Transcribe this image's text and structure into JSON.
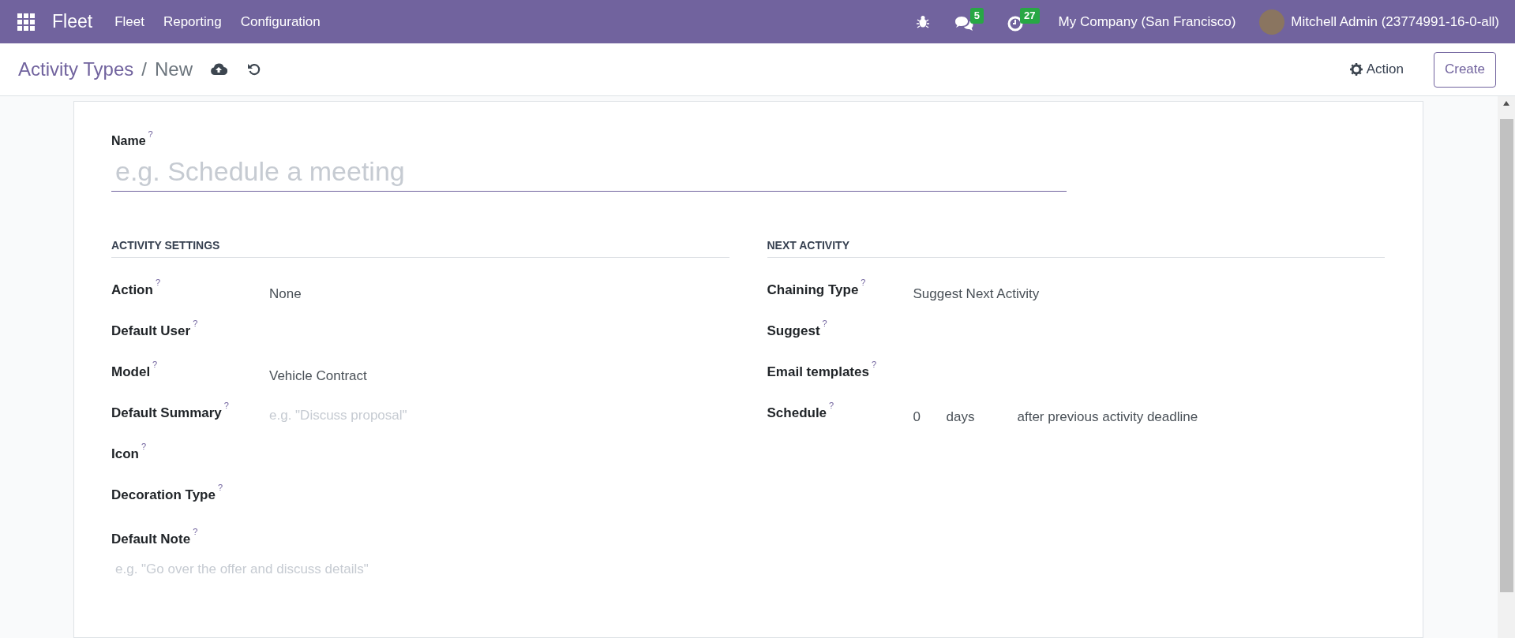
{
  "navbar": {
    "app_name": "Fleet",
    "menus": [
      "Fleet",
      "Reporting",
      "Configuration"
    ],
    "message_count": "5",
    "activity_count": "27",
    "company": "My Company (San Francisco)",
    "user": "Mitchell Admin (23774991-16-0-all)"
  },
  "control_panel": {
    "breadcrumb": "Activity Types",
    "separator": "/",
    "current": "New",
    "action_button": "Action",
    "create_button": "Create"
  },
  "form": {
    "name": {
      "label": "Name",
      "help": "?",
      "placeholder": "e.g. Schedule a meeting"
    },
    "sections": [
      {
        "title": "ACTIVITY SETTINGS",
        "fields": [
          {
            "kind": "value",
            "label": "Action",
            "help": "?",
            "value": "None"
          },
          {
            "kind": "empty",
            "label": "Default User",
            "help": "?"
          },
          {
            "kind": "value",
            "label": "Model",
            "help": "?",
            "value": "Vehicle Contract"
          },
          {
            "kind": "placeholder",
            "label": "Default Summary",
            "help": "?",
            "placeholder": "e.g. \"Discuss proposal\""
          },
          {
            "kind": "empty",
            "label": "Icon",
            "help": "?"
          },
          {
            "kind": "empty",
            "label": "Decoration Type",
            "help": "?"
          },
          {
            "kind": "note",
            "label": "Default Note",
            "help": "?",
            "placeholder": "e.g. \"Go over the offer and discuss details\""
          }
        ]
      },
      {
        "title": "NEXT ACTIVITY",
        "fields": [
          {
            "kind": "value",
            "label": "Chaining Type",
            "help": "?",
            "value": "Suggest Next Activity"
          },
          {
            "kind": "empty",
            "label": "Suggest",
            "help": "?"
          },
          {
            "kind": "empty",
            "label": "Email templates",
            "help": "?"
          },
          {
            "kind": "schedule",
            "label": "Schedule",
            "help": "?",
            "values": [
              "0",
              "days",
              "after previous activity deadline"
            ]
          }
        ]
      }
    ]
  }
}
